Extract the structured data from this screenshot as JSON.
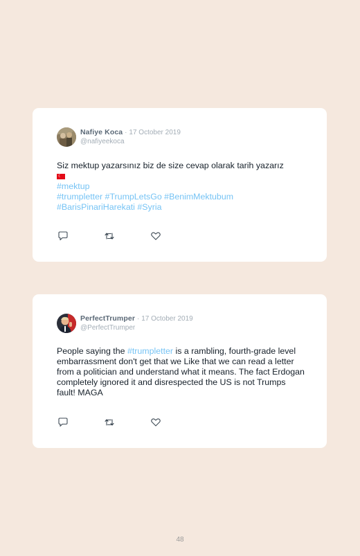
{
  "tweets": [
    {
      "author_name": "Nafiye Koca",
      "separator": "·",
      "date": "17 October 2019",
      "handle": "@nafiyeekoca",
      "text_line_1": "Siz mektup yazarsınız biz de size cevap olarak tarih yazarız",
      "flag_icon": "turkish-flag",
      "hashtags_line_1": "#mektup",
      "hashtags_line_2": "#trumpletter #TrumpLetsGo #BenimMektubum",
      "hashtags_line_3": "#BarisPinariHarekati #Syria"
    },
    {
      "author_name": "PerfectTrumper",
      "separator": "·",
      "date": "17 October 2019",
      "handle": "@PerfectTrumper",
      "text_before_tag": "People saying the ",
      "hashtag": "#trumpletter",
      "text_after_tag": " is a rambling, fourth-grade level embarrassment don't get that we Like that we can read a letter from a politician and understand what it means. The fact Erdogan completely ignored it and disrespected the US is not Trumps fault! MAGA"
    }
  ],
  "colors": {
    "background": "#f5e8de",
    "card": "#ffffff",
    "hashtag": "#2aa3ef",
    "name": "#5a6876",
    "muted": "#a3adb6"
  },
  "icons": [
    "reply-icon",
    "retweet-icon",
    "like-icon"
  ],
  "page_number": "48"
}
